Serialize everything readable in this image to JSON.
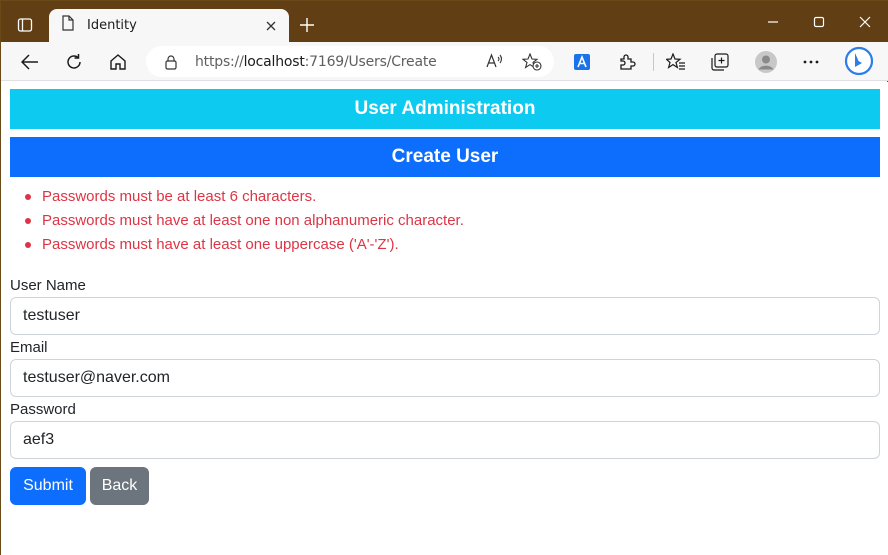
{
  "browser": {
    "tab_title": "Identity",
    "url_prefix": "https://",
    "url_host": "localhost",
    "url_rest": ":7169/Users/Create"
  },
  "page": {
    "banner_admin": "User Administration",
    "banner_create": "Create User",
    "errors": [
      "Passwords must be at least 6 characters.",
      "Passwords must have at least one non alphanumeric character.",
      "Passwords must have at least one uppercase ('A'-'Z')."
    ],
    "form": {
      "username_label": "User Name",
      "username_value": "testuser",
      "email_label": "Email",
      "email_value": "testuser@naver.com",
      "password_label": "Password",
      "password_value": "aef3"
    },
    "submit_label": "Submit",
    "back_label": "Back"
  },
  "colors": {
    "titlebar": "#613e14",
    "info_banner": "#0dcaf0",
    "primary": "#0d6efd",
    "secondary": "#6c757d",
    "danger": "#dc3545"
  }
}
